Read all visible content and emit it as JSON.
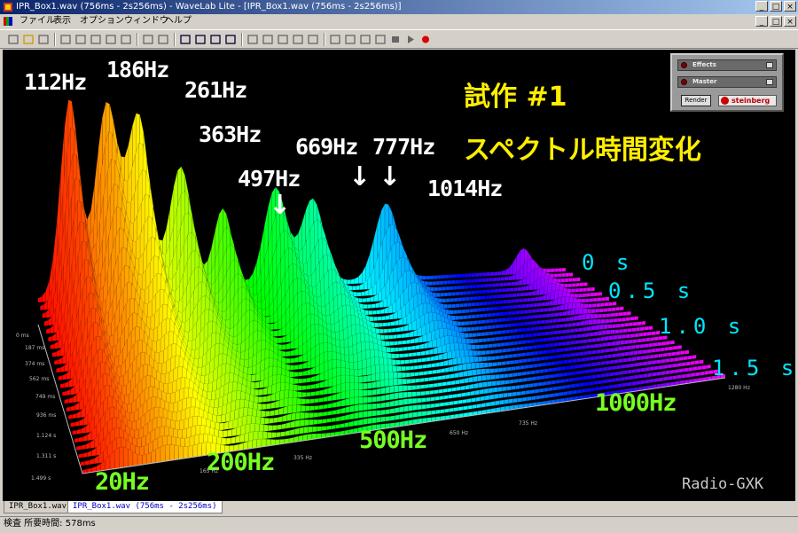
{
  "window": {
    "title": "IPR_Box1.wav (756ms - 2s256ms) - WaveLab Lite - [IPR_Box1.wav (756ms - 2s256ms)]"
  },
  "menu": [
    "ファイル",
    "表示",
    "オプション",
    "ウィンドウ",
    "ヘルプ"
  ],
  "toolbar_icons": [
    "new-icon",
    "open-icon",
    "save-icon",
    "cut-icon",
    "copy-icon",
    "paste-icon",
    "undo-icon",
    "redo-icon",
    "pencil-icon",
    "speaker-icon",
    "view-single-icon",
    "view-double-icon",
    "view-list-icon",
    "view-grid-icon",
    "cursor-icon",
    "zoom-icon",
    "crossfade-icon",
    "fade-icon",
    "tool-icon",
    "rewind-start-icon",
    "rewind-icon",
    "forward-icon",
    "end-icon",
    "stop-icon",
    "play-icon",
    "record-icon"
  ],
  "plot": {
    "peak_labels": [
      "112Hz",
      "186Hz",
      "261Hz",
      "363Hz",
      "497Hz",
      "669Hz",
      "777Hz",
      "1014Hz"
    ],
    "title_line1": "試作 #1",
    "title_line2": "スペクトル時間変化",
    "time_labels": [
      "0 s",
      "0.5 s",
      "1.0 s",
      "1.5 s"
    ],
    "freq_labels": [
      "20Hz",
      "200Hz",
      "500Hz",
      "1000Hz"
    ],
    "time_ticks": [
      "0 ms",
      "187 ms",
      "374 ms",
      "562 ms",
      "749 ms",
      "936 ms",
      "1.124 s",
      "1.311 s",
      "1.499 s"
    ],
    "freq_ticks": [
      "165 Hz",
      "335 Hz",
      "650 Hz",
      "735 Hz",
      "1280 Hz"
    ],
    "credit": "Radio-GXK",
    "arrow_glyph": "↓"
  },
  "effects_panel": {
    "effects_label": "Effects",
    "master_label": "Master",
    "render_label": "Render",
    "brand": "steinberg"
  },
  "tabs": [
    "IPR_Box1.wav",
    "IPR_Box1.wav (756ms - 2s256ms)"
  ],
  "status": {
    "text": "検査 所要時間: 578ms"
  }
}
